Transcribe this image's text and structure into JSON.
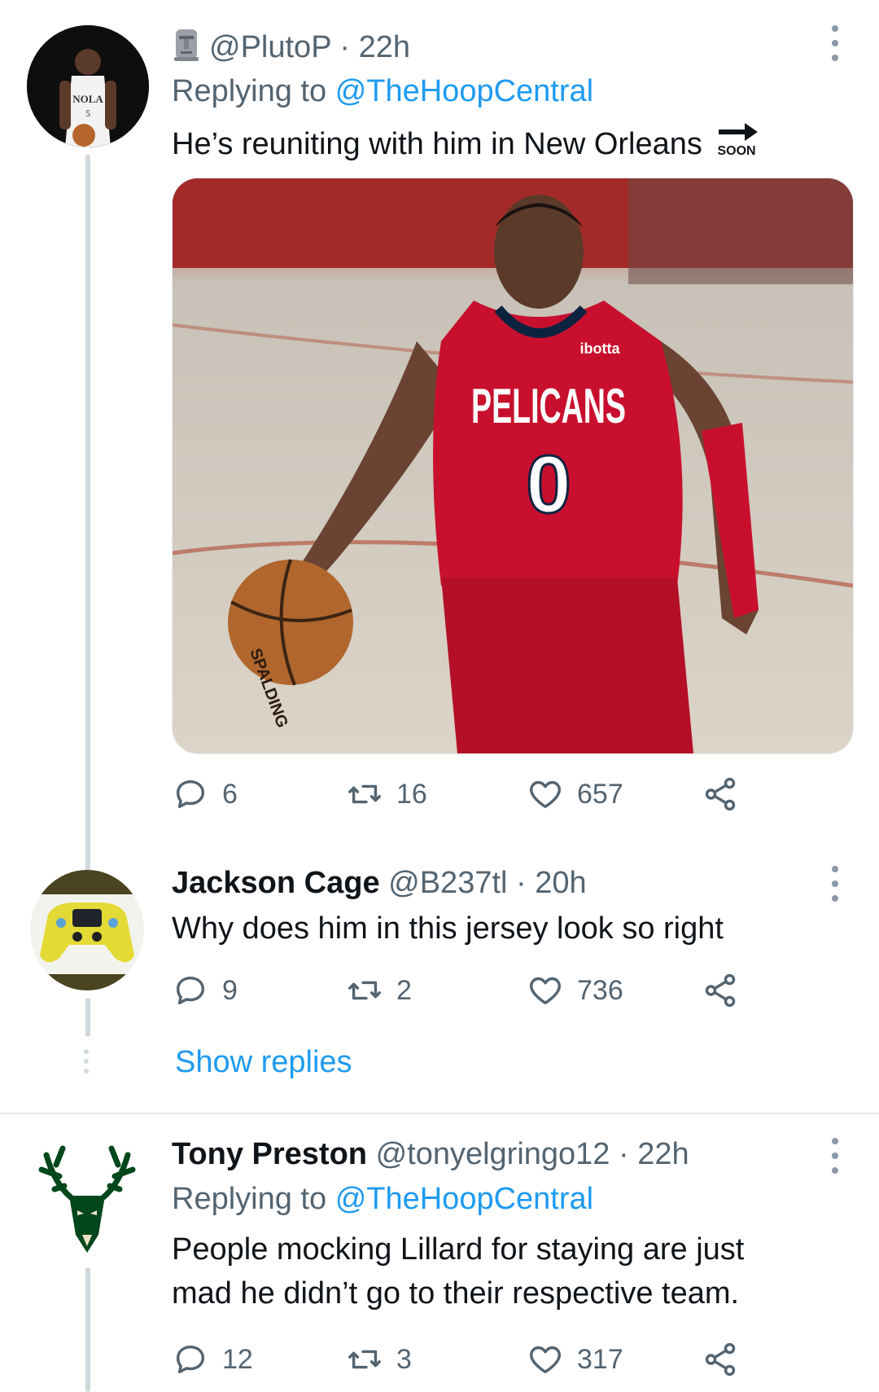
{
  "tweets": [
    {
      "handle": "@PlutoP",
      "time": "· 22h",
      "replying_label": "Replying to",
      "replying_to": "@TheHoopCentral",
      "text": "He’s reuniting with him in New Orleans",
      "soon_label": "SOON",
      "media": {
        "jersey_brand": "ibotta",
        "jersey_team": "PELICANS",
        "jersey_number": "0",
        "ball_brand": "SPALDING"
      },
      "replies": "6",
      "retweets": "16",
      "likes": "657"
    },
    {
      "name": "Jackson Cage",
      "handle": "@B237tl",
      "time": "· 20h",
      "text": "Why does him in this jersey look so right",
      "replies": "9",
      "retweets": "2",
      "likes": "736",
      "show_replies": "Show replies"
    },
    {
      "name": "Tony Preston",
      "handle": "@tonyelgringo12",
      "time": "· 22h",
      "replying_label": "Replying to",
      "replying_to": "@TheHoopCentral",
      "text_line1": "People mocking Lillard for staying are just",
      "text_line2": "mad he didn’t go to their respective team.",
      "replies": "12",
      "retweets": "3",
      "likes": "317"
    }
  ],
  "icons": {
    "reply": "reply-icon",
    "retweet": "retweet-icon",
    "like": "heart-icon",
    "share": "share-icon",
    "more": "more-options-icon",
    "moai": "moai-emoji-icon",
    "soon": "soon-arrow-emoji-icon"
  },
  "colors": {
    "link": "#1d9bf0",
    "muted": "#536471",
    "pelicans_red": "#c8102e",
    "bucks_green": "#00471b"
  }
}
